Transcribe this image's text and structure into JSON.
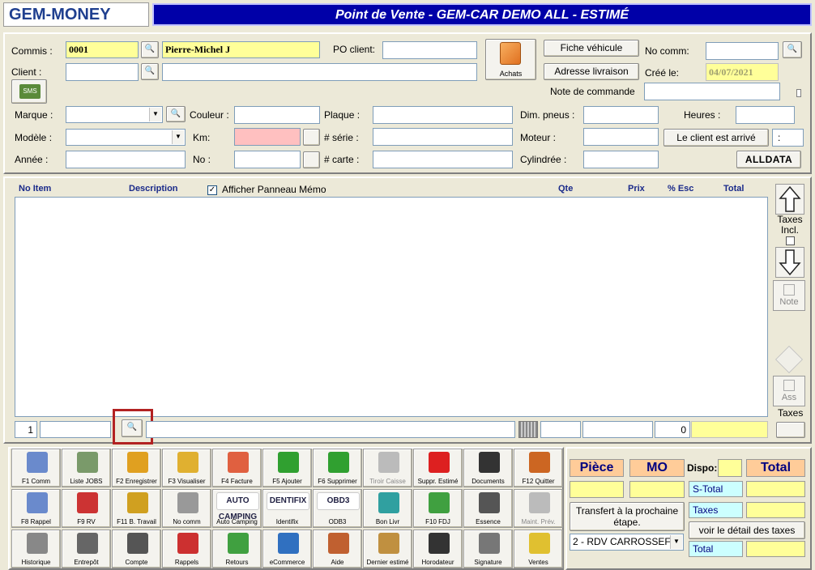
{
  "logo": "GEM-MONEY",
  "title": "Point de Vente - GEM-CAR DEMO ALL  - ESTIMÉ",
  "header": {
    "commis_label": "Commis :",
    "commis_code": "0001",
    "commis_name": "Pierre-Michel J",
    "po_label": "PO client:",
    "po_value": "",
    "achats_label": "Achats",
    "fiche_btn": "Fiche véhicule",
    "adresse_btn": "Adresse livraison",
    "nocomm_label": "No comm:",
    "nocomm_value": "",
    "cree_label": "Créé le:",
    "cree_value": "04/07/2021",
    "note_label": "Note de commande",
    "note_value": "",
    "client_label": "Client :",
    "client_code": "",
    "client_name": "",
    "sms_label": "SMS",
    "marque_label": "Marque :",
    "couleur_label": "Couleur :",
    "plaque_label": "Plaque :",
    "dim_label": "Dim. pneus :",
    "heures_label": "Heures :",
    "modele_label": "Modèle :",
    "km_label": "Km:",
    "serie_label": "# série :",
    "moteur_label": "Moteur :",
    "arrive_btn": "Le client est arrivé",
    "time_value": ":",
    "annee_label": "Année :",
    "no_label": "No :",
    "carte_label": "# carte :",
    "cylindree_label": "Cylindrée :",
    "alldata": "ALLDATA"
  },
  "grid": {
    "columns": [
      "No Item",
      "Description",
      "Qte",
      "Prix",
      "% Esc",
      "Total"
    ],
    "memo_label": "Afficher Panneau Mémo",
    "memo_checked": true,
    "footer_left": "1",
    "footer_right": "0"
  },
  "side": {
    "taxes_incl": "Taxes Incl.",
    "note": "Note",
    "ass": "Ass",
    "taxes": "Taxes"
  },
  "toolbar": [
    [
      "F1 Comm",
      "Liste JOBS",
      "F2 Enregistrer",
      "F3 Visualiser",
      "F4 Facture",
      "F5 Ajouter",
      "F6 Supprimer",
      "Tiroir Caisse",
      "Suppr. Estimé",
      "Documents",
      "F12 Quitter"
    ],
    [
      "F8 Rappel",
      "F9 RV",
      "F11 B. Travail",
      "No comm",
      "Auto Camping",
      "Identifix",
      "ODB3",
      "Bon Livr",
      "F10 FDJ",
      "Essence",
      "Maint. Prév."
    ],
    [
      "Historique",
      "Entrepôt",
      "Compte",
      "Rappels",
      "Retours",
      "eCommerce",
      "Aide",
      "Dernier estimé",
      "Horodateur",
      "Signature",
      "Ventes"
    ]
  ],
  "toolbar_logos": {
    "auto": "AUTO CAMPING",
    "dentifix": "DENTIFIX",
    "obd3": "OBD3"
  },
  "totals": {
    "piece": "Pièce",
    "mo": "MO",
    "dispo": "Dispo:",
    "total": "Total",
    "stotal": "S-Total",
    "taxes": "Taxes",
    "total2": "Total",
    "transfert": "Transfert à la prochaine étape.",
    "detail_btn": "voir le détail des taxes",
    "step_select": "2 - RDV CARROSSEF"
  },
  "colors": {
    "title_bg": "#0000a8",
    "highlight_red": "#b22222",
    "yellow": "#ffff99",
    "pink": "#ffc0c0",
    "orange": "#ffcc99",
    "cyan": "#ccffff"
  }
}
